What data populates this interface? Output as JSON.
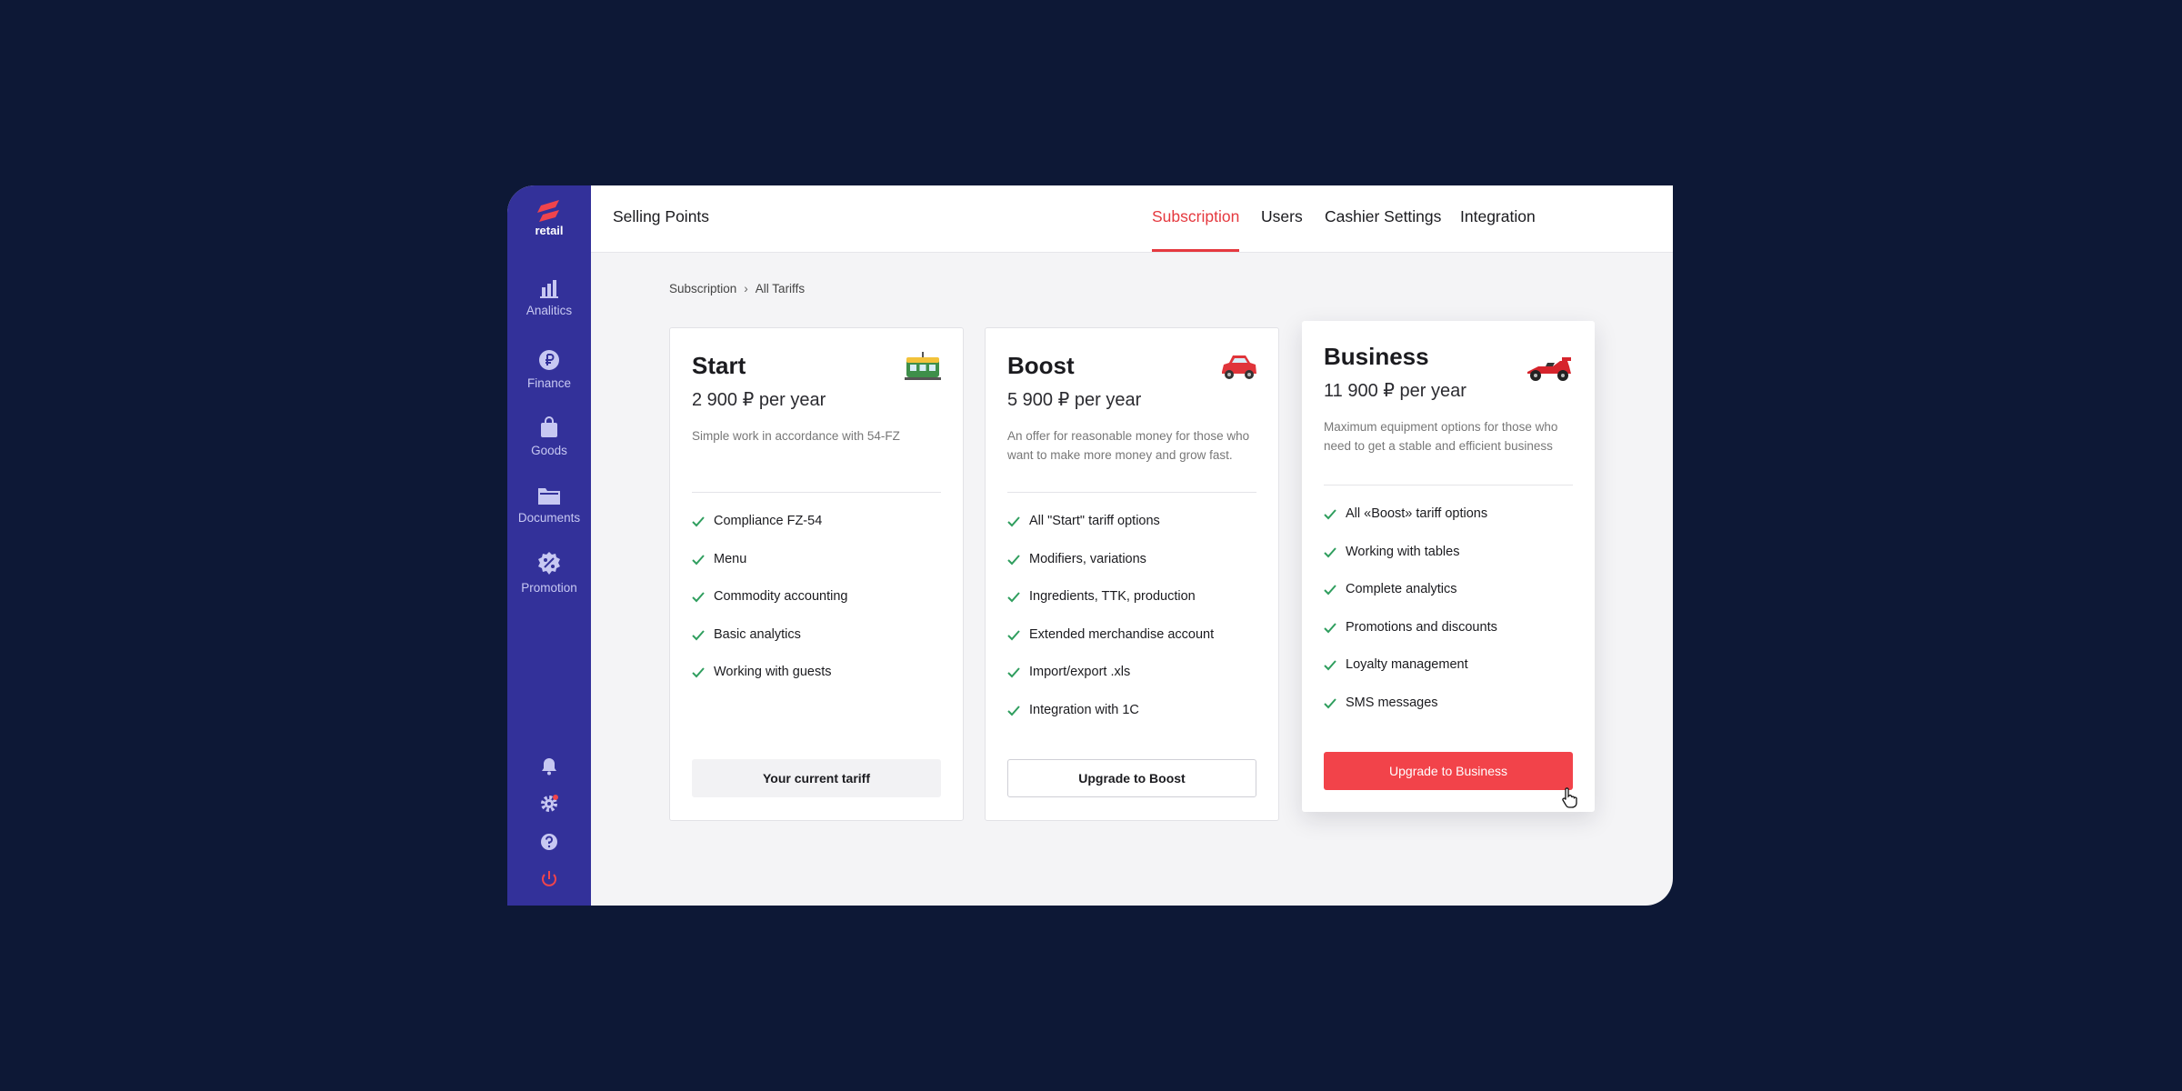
{
  "brand": {
    "name": "retail"
  },
  "sidebar": {
    "items": [
      {
        "label": "Analitics",
        "icon": "bar-chart-icon"
      },
      {
        "label": "Finance",
        "icon": "ruble-coin-icon"
      },
      {
        "label": "Goods",
        "icon": "shopping-bag-icon"
      },
      {
        "label": "Documents",
        "icon": "folder-icon"
      },
      {
        "label": "Promotion",
        "icon": "percent-badge-icon"
      }
    ],
    "bottom": [
      "bell-icon",
      "gear-icon",
      "help-icon",
      "power-icon"
    ]
  },
  "tabs": [
    {
      "label": "Selling Points"
    },
    {
      "label": "Subscription",
      "active": true
    },
    {
      "label": "Users"
    },
    {
      "label": "Cashier Settings"
    },
    {
      "label": "Integration"
    }
  ],
  "breadcrumb": {
    "parent": "Subscription",
    "separator": "›",
    "current": "All Tariffs"
  },
  "plans": [
    {
      "title": "Start",
      "price": "2 900 ₽ per year",
      "description": "Simple work in accordance with 54-FZ",
      "icon": "tram-icon",
      "features": [
        "Compliance FZ-54",
        "Menu",
        "Commodity accounting",
        "Basic analytics",
        "Working with guests"
      ],
      "button": "Your current tariff"
    },
    {
      "title": "Boost",
      "price": "5 900 ₽ per year",
      "description": "An offer for reasonable money for those who want to make more money and grow fast.",
      "icon": "car-icon",
      "features": [
        "All \"Start\" tariff options",
        "Modifiers, variations",
        "Ingredients, TTK, production",
        "Extended merchandise account",
        "Import/export .xls",
        "Integration with 1C"
      ],
      "button": "Upgrade to Boost"
    },
    {
      "title": "Business",
      "price": "11 900 ₽ per year",
      "description": "Maximum equipment options for those who need to get a stable and efficient business",
      "icon": "race-car-icon",
      "features": [
        "All «Boost» tariff options",
        "Working with tables",
        "Complete analytics",
        "Promotions and discounts",
        "Loyalty management",
        "SMS messages"
      ],
      "button": "Upgrade to Business"
    }
  ],
  "colors": {
    "background": "#0d1836",
    "sidebar": "#33319a",
    "accent": "#e5393f",
    "primary_button": "#f2434a",
    "check": "#2f9e5e"
  }
}
